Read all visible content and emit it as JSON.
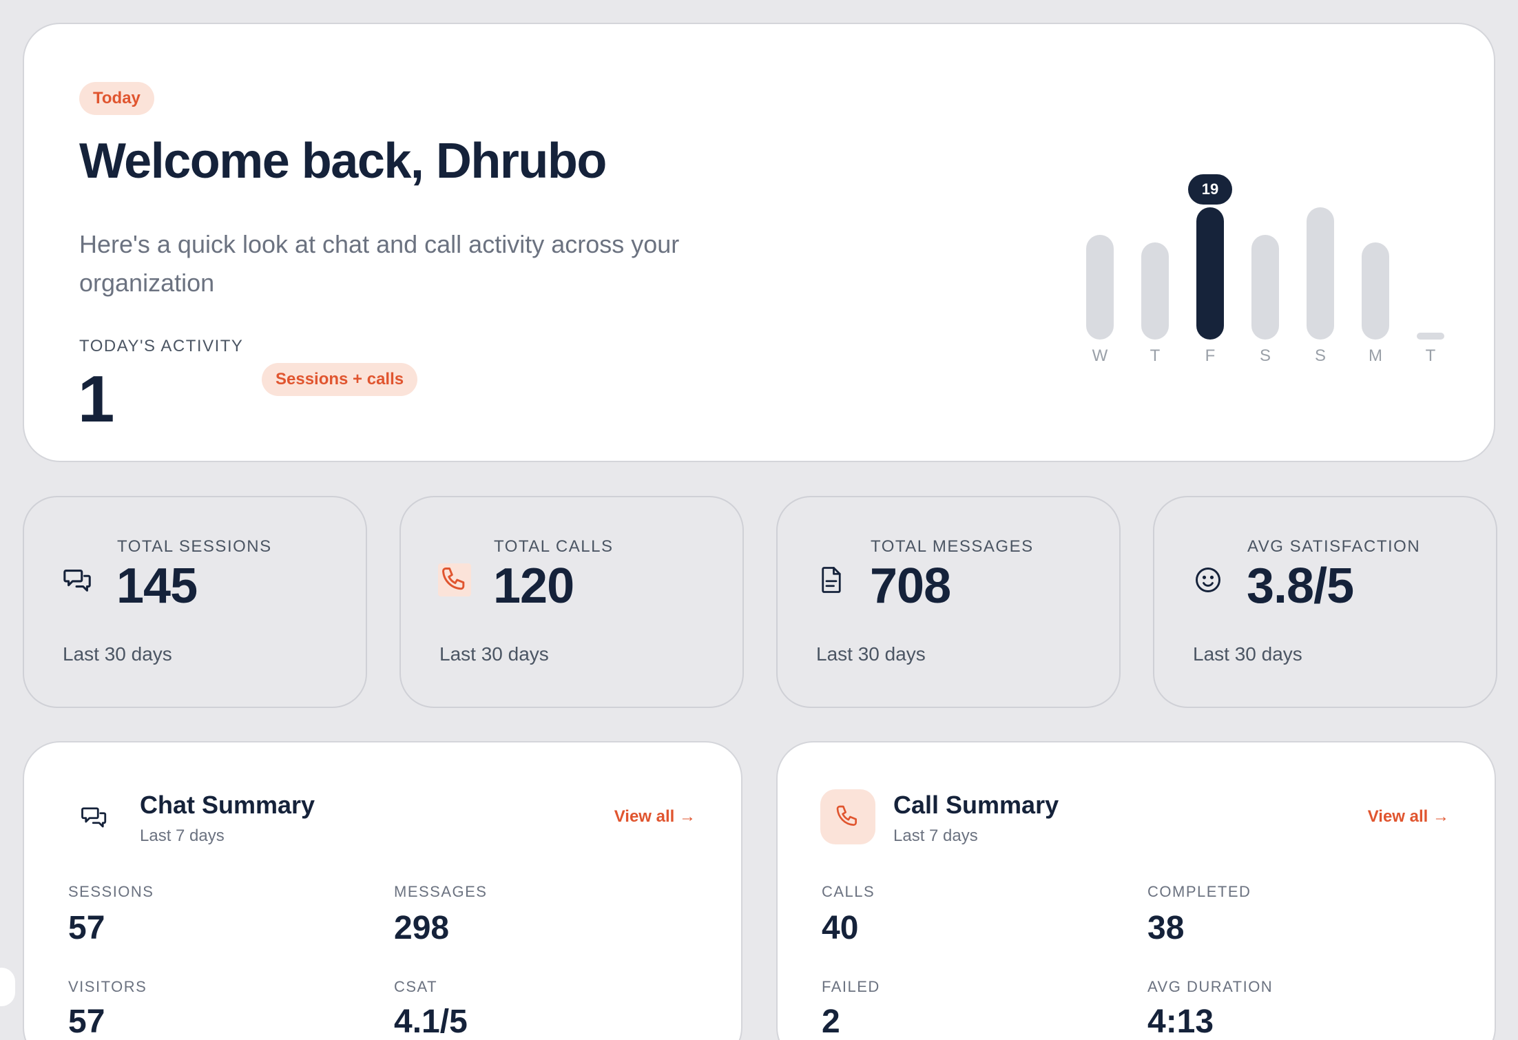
{
  "hero": {
    "badge": "Today",
    "title": "Welcome back, Dhrubo",
    "subtitle": "Here's a quick look at chat and call activity across your organization",
    "activity_label": "TODAY'S ACTIVITY",
    "activity_value": "1",
    "activity_badge": "Sessions + calls"
  },
  "chart_data": {
    "type": "bar",
    "categories": [
      "W",
      "T",
      "F",
      "S",
      "S",
      "M",
      "T"
    ],
    "values": [
      15,
      14,
      19,
      15,
      19,
      14,
      0
    ],
    "highlighted_index": 2,
    "highlight_label": "19",
    "ylim": [
      0,
      19
    ],
    "title": "",
    "xlabel": "",
    "ylabel": ""
  },
  "stats": [
    {
      "label": "TOTAL SESSIONS",
      "value": "145",
      "foot": "Last 30 days",
      "icon": "chat-bubbles-icon"
    },
    {
      "label": "TOTAL CALLS",
      "value": "120",
      "foot": "Last 30 days",
      "icon": "phone-icon"
    },
    {
      "label": "TOTAL MESSAGES",
      "value": "708",
      "foot": "Last 30 days",
      "icon": "document-icon"
    },
    {
      "label": "AVG SATISFACTION",
      "value": "3.8/5",
      "foot": "Last 30 days",
      "icon": "smiley-icon"
    }
  ],
  "chat_summary": {
    "title": "Chat Summary",
    "subtitle": "Last 7 days",
    "view_all": "View all →",
    "metrics": [
      {
        "label": "SESSIONS",
        "value": "57"
      },
      {
        "label": "MESSAGES",
        "value": "298"
      },
      {
        "label": "VISITORS",
        "value": "57"
      },
      {
        "label": "CSAT",
        "value": "4.1/5"
      }
    ]
  },
  "call_summary": {
    "title": "Call Summary",
    "subtitle": "Last 7 days",
    "view_all": "View all →",
    "metrics": [
      {
        "label": "CALLS",
        "value": "40"
      },
      {
        "label": "COMPLETED",
        "value": "38"
      },
      {
        "label": "FAILED",
        "value": "2"
      },
      {
        "label": "AVG DURATION",
        "value": "4:13"
      }
    ]
  },
  "colors": {
    "accent": "#e0552f",
    "accent_soft": "#fbe3d9",
    "ink": "#15223a",
    "bar_inactive": "#d9dbe0",
    "bar_active": "#16233a"
  }
}
